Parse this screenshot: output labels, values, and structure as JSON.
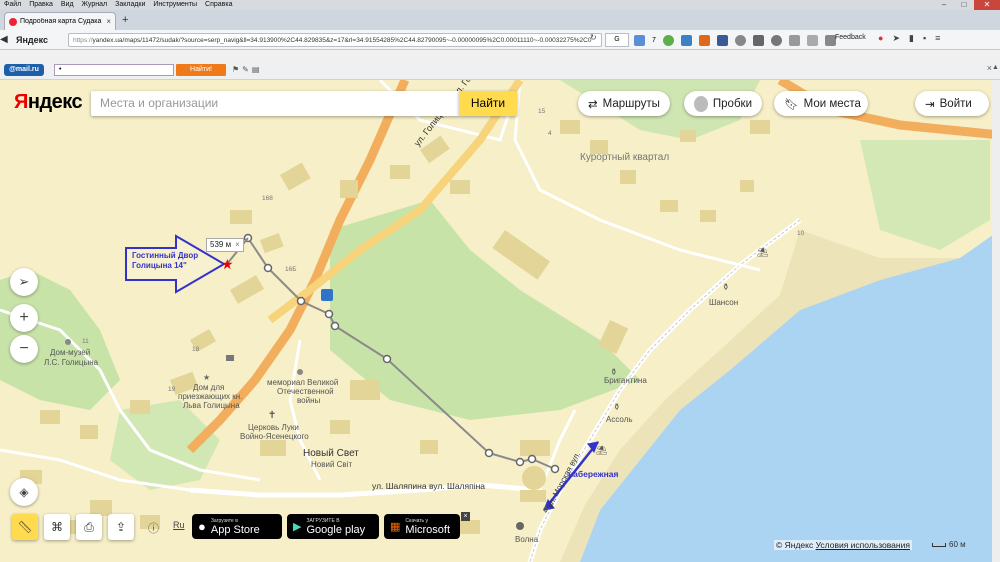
{
  "os_menu": {
    "items": [
      "Файл",
      "Правка",
      "Вид",
      "Журнал",
      "Закладки",
      "Инструменты",
      "Справка"
    ]
  },
  "browser": {
    "tab_title": "Подробная карта Судака ...",
    "tab_close": "×",
    "new_tab": "+",
    "brand": "Яндекс",
    "url_scheme": "https://",
    "url_rest": "yandex.ua/maps/11472/sudak/?source=serp_navig&ll=34.913900%2C44.829835&z=17&rl=34.91554285%2C44.82790095~-0.00000095%2C0.00011110~-0.00032275%2C0",
    "search_engine": "G",
    "counter": "7",
    "feedback": "Feedback",
    "colors": {
      "chrome": "#cfd6de",
      "close": "#c9463d"
    }
  },
  "mail_bar": {
    "logo": "@mail.ru",
    "input_value": "•",
    "search_button": "Найти!",
    "icons": "⚑✎▤"
  },
  "map_ui": {
    "logo_prefix": "Я",
    "logo_rest": "ндекс",
    "search_placeholder": "Места и организации",
    "search_button": "Найти",
    "routes": "Маршруты",
    "traffic": "Пробки",
    "my_places": "Мои места",
    "login": "Войти",
    "zoom_in": "+",
    "zoom_out": "−",
    "ruler_label": "Ru",
    "stores": [
      {
        "top": "Загрузите в",
        "name": "App Store",
        "icon": "apple-icon"
      },
      {
        "top": "ЗАГРУЗИТЕ В",
        "name": "Google play",
        "icon": "play-icon"
      },
      {
        "top": "Скачать у",
        "name": "Microsoft",
        "icon": "windows-icon"
      }
    ],
    "store_close": "×",
    "copyright": "© Яндекс",
    "terms": "Условия использования",
    "scale": "60 м",
    "distance": "539 м",
    "distance_close": "×"
  },
  "annotations": {
    "hotel_line1": "Гостинный Двор",
    "hotel_line2": "Голицына 14\"",
    "quay": "набережная"
  },
  "map_labels": {
    "district": "Курортный квартал",
    "street_golitsyna": "ул. Голицына вул. Голіцина",
    "street_shalyapina": "ул. Шаляпина вул. Шаляпіна",
    "street_morskaya": "ул. Морская вул.",
    "museum1": "Дом-музей",
    "museum2": "Л.С. Голицына",
    "house1": "Дом для",
    "house2": "приезжающих кн.",
    "house3": "Льва Голицына",
    "memorial1": "мемориал Великой",
    "memorial2": "Отечественной",
    "memorial3": "войны",
    "church1": "Церковь Луки",
    "church2": "Войно-Ясенецкого",
    "newworld1": "Новый Свет",
    "newworld2": "Новий Світ",
    "chanson": "Шансон",
    "brigantina": "Бригантина",
    "asol": "Ассоль",
    "volna": "Волна",
    "n168a": "168",
    "n168b": "16Б",
    "n18": "18",
    "n11": "11",
    "n19": "19",
    "n15": "15",
    "n10": "10",
    "n4": "4"
  },
  "colors": {
    "land": "#f6efc7",
    "sea": "#abd3f2",
    "road_major": "#f2ae5c",
    "road_yellow": "#f7d37c",
    "green": "#c8e3a8",
    "building": "#e3d597",
    "route": "#8a8a8a",
    "annotation": "#3333cc",
    "search_button": "#ffdb4d"
  }
}
